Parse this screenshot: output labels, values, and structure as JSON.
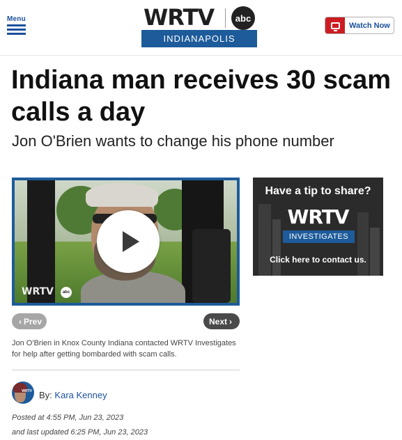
{
  "header": {
    "menu_label": "Menu",
    "logo_wordmark": "WRTV",
    "logo_network": "abc",
    "logo_city": "INDIANAPOLIS",
    "watch_now_label": "Watch Now"
  },
  "article": {
    "headline": "Indiana man receives 30 scam calls a day",
    "subhead": "Jon O'Brien wants to change his phone number"
  },
  "video": {
    "watermark": "WRTV",
    "watermark_network": "abc",
    "caption": "Jon O'Brien in Knox County Indiana contacted WRTV Investigates for help after getting bombarded with scam calls."
  },
  "gallery_nav": {
    "prev_label": "Prev",
    "next_label": "Next"
  },
  "byline": {
    "avatar_mark": "WRTV",
    "prefix": "By:",
    "author": "Kara Kenney",
    "posted": "Posted at 4:55 PM, Jun 23, 2023",
    "updated": "and last updated 6:25 PM, Jun 23, 2023"
  },
  "promo": {
    "title": "Have a tip to share?",
    "logo": "WRTV",
    "badge": "INVESTIGATES",
    "cta": "Click here to contact us."
  },
  "colors": {
    "brand_blue": "#1d5b9a",
    "link_blue": "#1b4f9c",
    "watch_red": "#cc1d23"
  }
}
